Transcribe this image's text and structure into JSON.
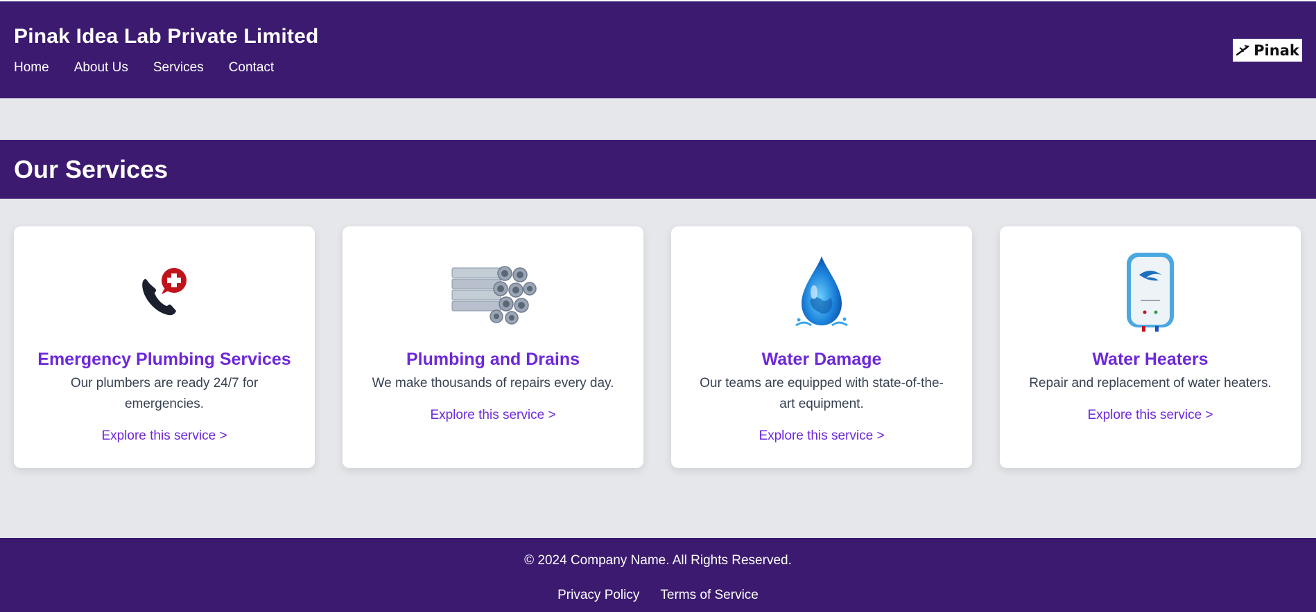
{
  "header": {
    "title": "Pinak Idea Lab Private Limited",
    "nav": [
      "Home",
      "About Us",
      "Services",
      "Contact"
    ],
    "logo_text": "Pinak"
  },
  "services_section": {
    "title": "Our Services",
    "cards": [
      {
        "icon": "emergency-phone-icon",
        "title": "Emergency Plumbing Services",
        "description": "Our plumbers are ready 24/7 for emergencies.",
        "link": "Explore this service >"
      },
      {
        "icon": "pipes-icon",
        "title": "Plumbing and Drains",
        "description": "We make thousands of repairs every day.",
        "link": "Explore this service >"
      },
      {
        "icon": "water-drop-icon",
        "title": "Water Damage",
        "description": "Our teams are equipped with state-of-the-art equipment.",
        "link": "Explore this service >"
      },
      {
        "icon": "water-heater-icon",
        "title": "Water Heaters",
        "description": "Repair and replacement of water heaters.",
        "link": "Explore this service >"
      }
    ]
  },
  "footer": {
    "copyright": "© 2024 Company Name. All Rights Reserved.",
    "links": [
      "Privacy Policy",
      "Terms of Service"
    ]
  },
  "colors": {
    "brand_purple": "#3b1a6f",
    "accent_violet": "#6d28d9",
    "page_bg": "#e5e7eb"
  }
}
